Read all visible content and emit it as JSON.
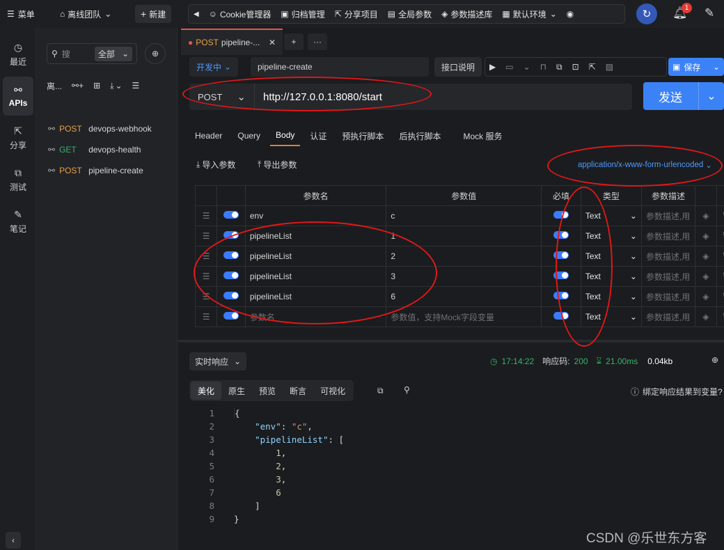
{
  "topbar": {
    "menu_label": "菜单",
    "team_label": "离线团队",
    "new_label": "新建",
    "tools": [
      "Cookie管理器",
      "归档管理",
      "分享项目",
      "全局参数",
      "参数描述库",
      "默认环境"
    ],
    "notification_count": "1"
  },
  "rail": {
    "items": [
      "最近",
      "APIs",
      "分享",
      "测试",
      "笔记"
    ]
  },
  "tree": {
    "search_placeholder": "搜",
    "filter_label": "全部",
    "project_label": "离...",
    "items": [
      {
        "method": "POST",
        "name": "devops-webhook"
      },
      {
        "method": "GET",
        "name": "devops-health"
      },
      {
        "method": "POST",
        "name": "pipeline-create"
      }
    ]
  },
  "request": {
    "tab_method": "POST",
    "tab_name": "pipeline-...",
    "env_label": "开发中",
    "name": "pipeline-create",
    "doc_label": "接口说明",
    "save_label": "保存",
    "method": "POST",
    "url": "http://127.0.0.1:8080/start",
    "send_label": "发送",
    "subtabs": [
      "Header",
      "Query",
      "Body",
      "认证",
      "预执行脚本",
      "后执行脚本",
      "Mock 服务"
    ],
    "import_label": "导入参数",
    "export_label": "导出参数",
    "content_type": "application/x-www-form-urlencoded"
  },
  "params": {
    "headers": [
      "参数名",
      "参数值",
      "必填",
      "类型",
      "参数描述"
    ],
    "rows": [
      {
        "name": "env",
        "value": "c",
        "type": "Text",
        "desc": "参数描述,用"
      },
      {
        "name": "pipelineList",
        "value": "1",
        "type": "Text",
        "desc": "参数描述,用"
      },
      {
        "name": "pipelineList",
        "value": "2",
        "type": "Text",
        "desc": "参数描述,用"
      },
      {
        "name": "pipelineList",
        "value": "3",
        "type": "Text",
        "desc": "参数描述,用"
      },
      {
        "name": "pipelineList",
        "value": "6",
        "type": "Text",
        "desc": "参数描述,用"
      },
      {
        "name": "参数名",
        "value": "参数值，支持Mock字段变量",
        "type": "Text",
        "desc": "参数描述,用"
      }
    ]
  },
  "response": {
    "mode_label": "实时响应",
    "time": "17:14:22",
    "status_label": "响应码:",
    "status": "200",
    "duration": "21.00ms",
    "size": "0.04kb",
    "tabs": [
      "美化",
      "原生",
      "预览",
      "断言",
      "可视化"
    ],
    "bind_label": "绑定响应结果到变量?",
    "line_numbers": [
      "1",
      "2",
      "3",
      "4",
      "5",
      "6",
      "7",
      "8",
      "9"
    ]
  },
  "watermark": "CSDN @乐世东方客",
  "colors": {
    "accent": "#4c9aff",
    "send": "#3b82f6",
    "post": "#e8a046",
    "get": "#37b36a",
    "annotation": "#e01818"
  }
}
